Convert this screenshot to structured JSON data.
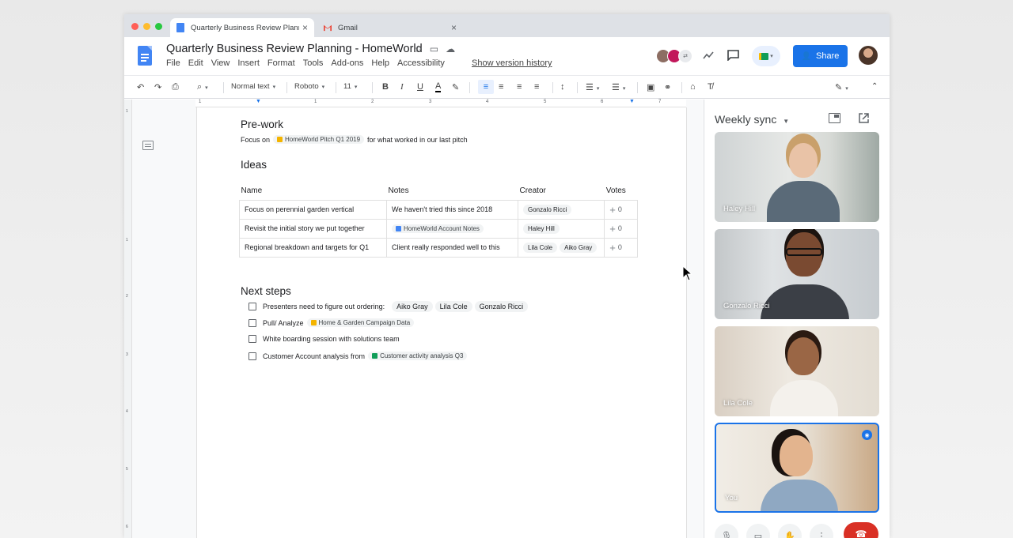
{
  "browser": {
    "tabs": [
      {
        "title": "Quarterly Business Review Plann",
        "close": "×"
      },
      {
        "title": "Gmail",
        "close": "×"
      }
    ]
  },
  "header": {
    "title": "Quarterly Business Review Planning - HomeWorld",
    "menus": [
      "File",
      "Edit",
      "View",
      "Insert",
      "Format",
      "Tools",
      "Add-ons",
      "Help",
      "Accessibility"
    ],
    "version_history": "Show version history",
    "share_label": "Share"
  },
  "toolbar": {
    "style": "Normal text",
    "font": "Roboto",
    "size": "11"
  },
  "ruler": {
    "h_ticks": [
      "1",
      "1",
      "2",
      "3",
      "4",
      "5",
      "6",
      "7"
    ],
    "v_ticks": [
      "1",
      "1",
      "2",
      "3",
      "4",
      "5",
      "6"
    ]
  },
  "doc": {
    "prework_heading": "Pre-work",
    "prework_before": "Focus on",
    "prework_chip": "HomeWorld Pitch Q1 2019",
    "prework_after": "for what worked in our last pitch",
    "ideas_heading": "Ideas",
    "table": {
      "headers": [
        "Name",
        "Notes",
        "Creator",
        "Votes"
      ],
      "rows": [
        {
          "name": "Focus on perennial garden vertical",
          "notes": "We haven't tried this since 2018",
          "creators": [
            "Gonzalo Ricci"
          ],
          "votes": "0"
        },
        {
          "name": "Revisit the initial story we put together",
          "notes_chip": "HomeWorld Account Notes",
          "creators": [
            "Haley Hill"
          ],
          "votes": "0"
        },
        {
          "name": "Regional breakdown and targets for Q1",
          "notes": "Client really responded well to this",
          "creators": [
            "Lila Cole",
            "Aiko Gray"
          ],
          "votes": "0"
        }
      ]
    },
    "next_heading": "Next steps",
    "steps": [
      {
        "text": "Presenters need to figure out ordering:",
        "people": [
          "Aiko Gray",
          "Lila Cole",
          "Gonzalo Ricci"
        ]
      },
      {
        "text": "Pull/ Analyze",
        "chip": "Home & Garden Campaign Data"
      },
      {
        "text": "White boarding session with solutions team"
      },
      {
        "text": "Customer Account analysis from",
        "chip": "Customer activity analysis Q3"
      }
    ]
  },
  "meet": {
    "title": "Weekly sync",
    "participants": [
      {
        "name": "Haley Hill"
      },
      {
        "name": "Gonzalo Ricci"
      },
      {
        "name": "Lila Cole"
      },
      {
        "name": "You"
      }
    ]
  },
  "colors": {
    "accent": "#1a73e8",
    "docs_blue": "#4285f4",
    "hangup": "#d93025",
    "slides_yellow": "#f4b400",
    "sheets_green": "#0f9d58"
  }
}
